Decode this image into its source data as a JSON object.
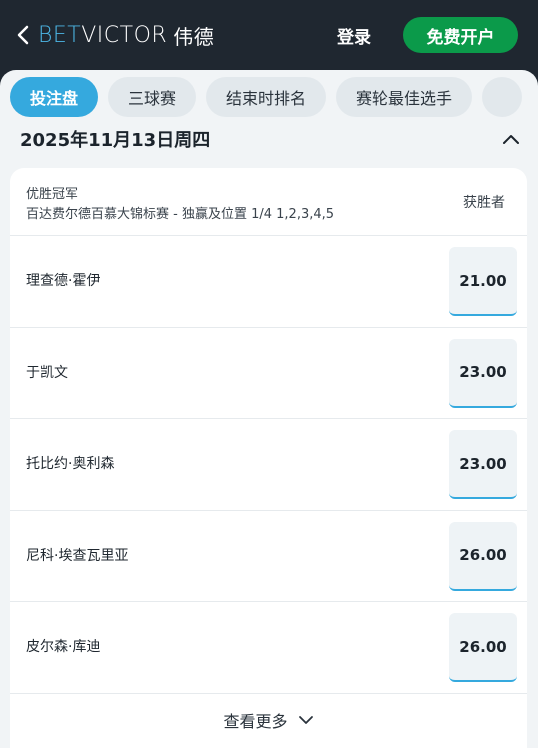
{
  "header": {
    "logo_bet": "BET",
    "logo_victor": "VICTOR",
    "logo_region": "伟德",
    "login_label": "登录",
    "signup_label": "免费开户"
  },
  "tabs": [
    {
      "label": "投注盘",
      "active": true
    },
    {
      "label": "三球赛",
      "active": false
    },
    {
      "label": "结束时排名",
      "active": false
    },
    {
      "label": "赛轮最佳选手",
      "active": false
    },
    {
      "label": "",
      "active": false
    }
  ],
  "date_title": "2025年11月13日周四",
  "market": {
    "name": "优胜冠军",
    "description": "百达费尔德百慕大锦标赛 - 独赢及位置 1/4 1,2,3,4,5",
    "column_label": "获胜者"
  },
  "runners": [
    {
      "name": "理查德·霍伊",
      "price": "21.00"
    },
    {
      "name": "于凯文",
      "price": "23.00"
    },
    {
      "name": "托比约·奥利森",
      "price": "23.00"
    },
    {
      "name": "尼科·埃查瓦里亚",
      "price": "26.00"
    },
    {
      "name": "皮尔森·库迪",
      "price": "26.00"
    }
  ],
  "more_label": "查看更多",
  "colors": {
    "header_bg": "#1f2730",
    "brand_blue": "#4cb7e6",
    "active_tab": "#35a9de",
    "signup_green": "#0b9a4a"
  },
  "icons": {
    "back": "chevron-left-icon",
    "collapse": "chevron-up-icon",
    "expand": "chevron-down-icon"
  }
}
